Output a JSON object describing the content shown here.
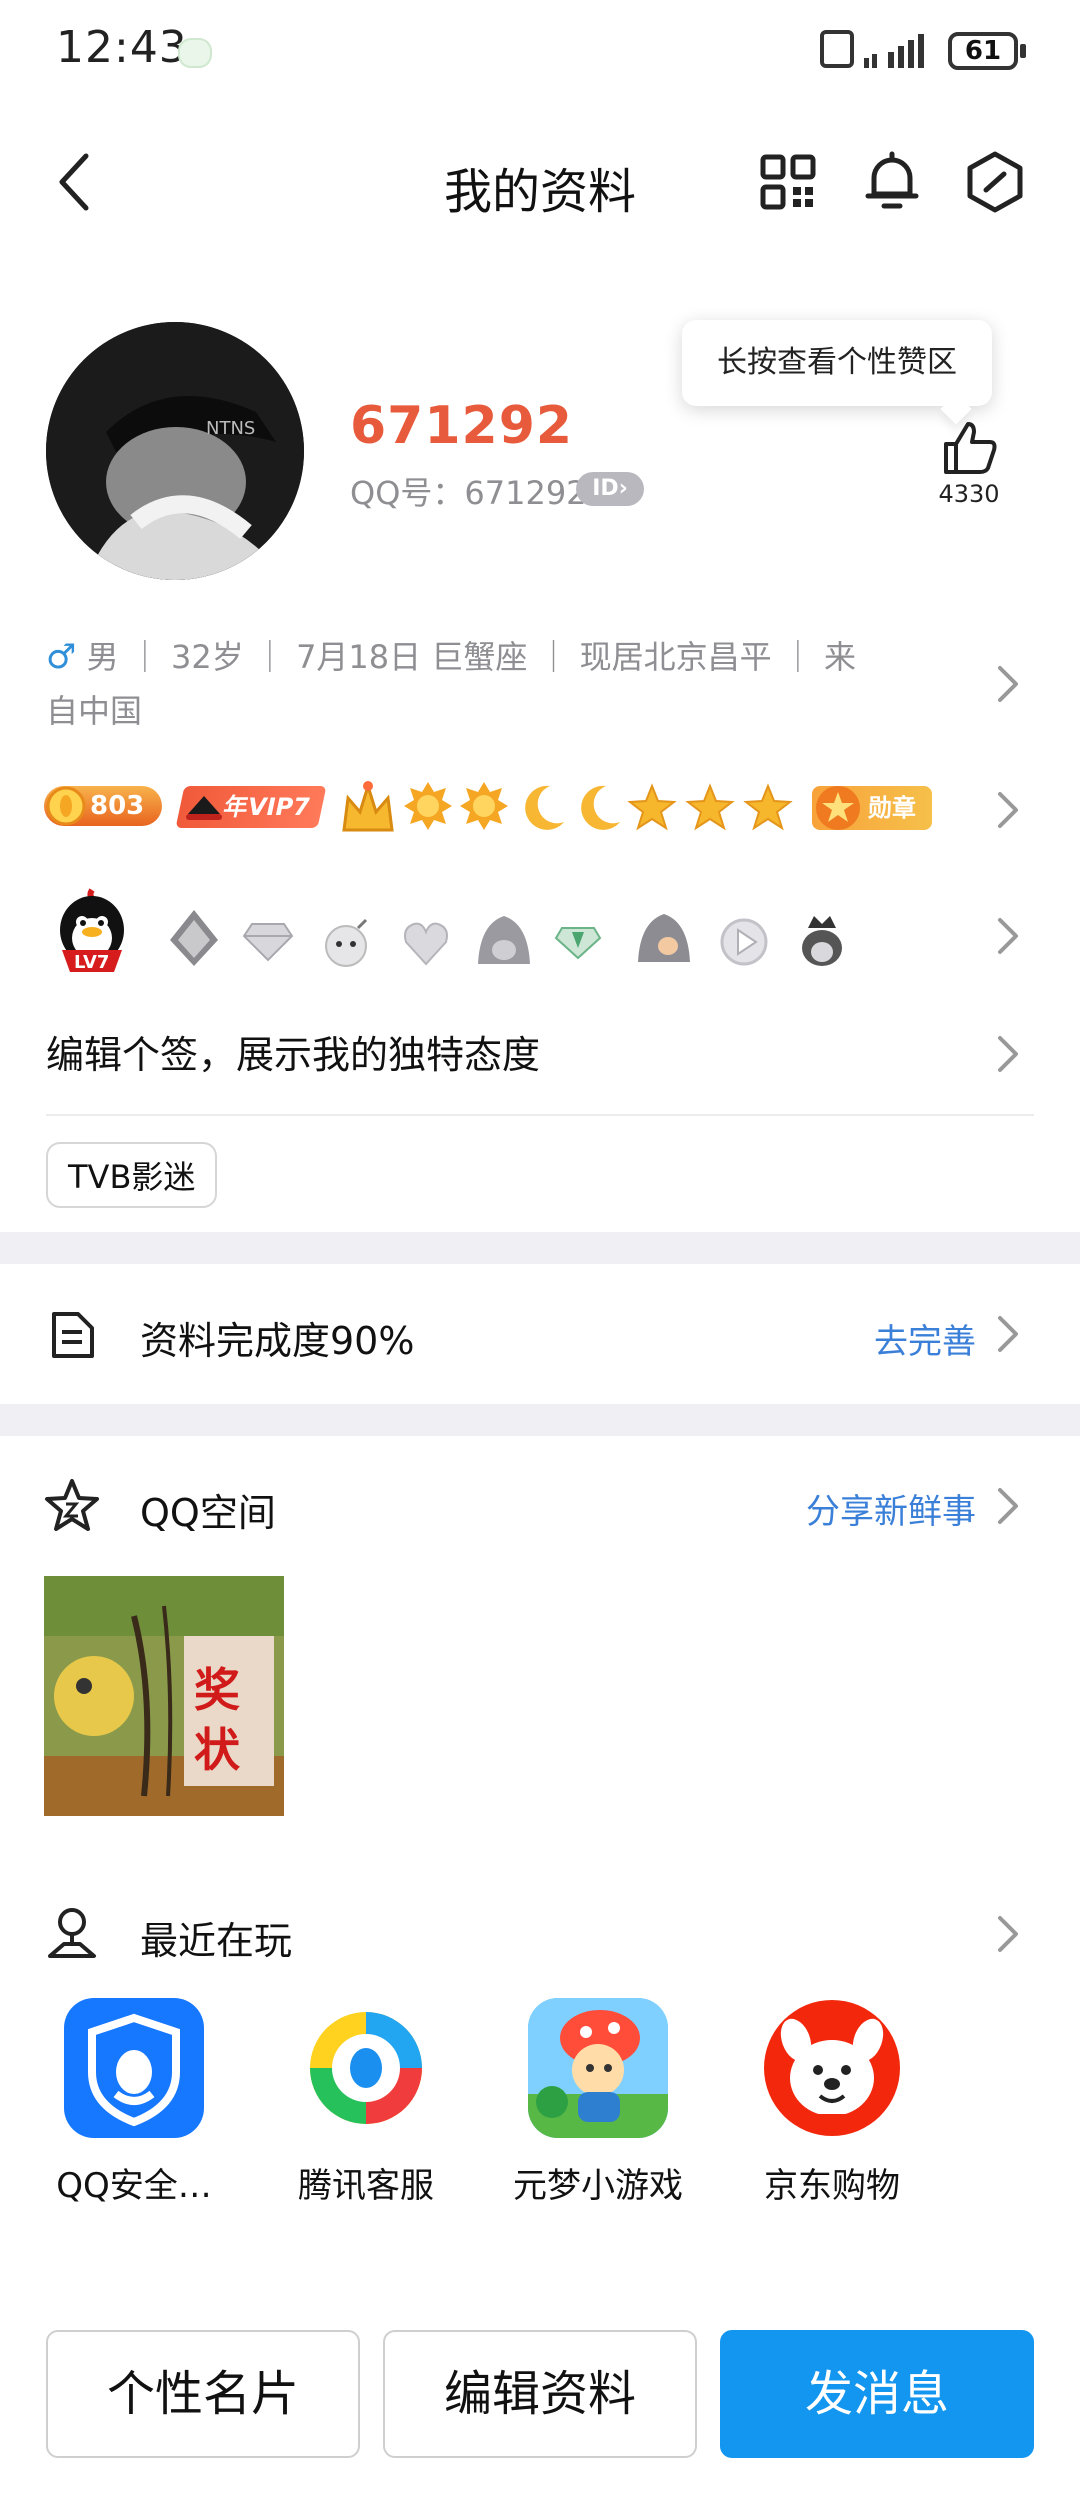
{
  "status_bar": {
    "time": "12:43",
    "battery": "61"
  },
  "header": {
    "title": "我的资料"
  },
  "profile": {
    "nickname": "671292",
    "qq_label": "QQ号：671292",
    "id_badge": "ID",
    "like_tooltip": "长按查看个性赞区",
    "like_count": "4330"
  },
  "info": {
    "gender_symbol": "♂",
    "line1": " 男 ｜ 32岁 ｜ 7月18日  巨蟹座 ｜ 现居北京昌平 ｜ 来",
    "line2": "自中国"
  },
  "badges": {
    "score": "803",
    "vip": "年VIP7",
    "medal": "勋章"
  },
  "level_badge": "LV7",
  "signature": "编辑个签，展示我的独特态度",
  "tag": "TVB影迷",
  "completion": {
    "label": "资料完成度90%",
    "action": "去完善"
  },
  "qzone": {
    "label": "QQ空间",
    "action": "分享新鲜事",
    "photo_text": [
      "奖",
      "状"
    ]
  },
  "recent": {
    "label": "最近在玩",
    "games": [
      {
        "name": "QQ安全…"
      },
      {
        "name": "腾讯客服"
      },
      {
        "name": "元梦小游戏"
      },
      {
        "name": "京东购物"
      }
    ]
  },
  "buttons": {
    "card": "个性名片",
    "edit": "编辑资料",
    "message": "发消息"
  },
  "colors": {
    "accent_blue": "#1296f0",
    "link_blue": "#3a7fd8",
    "nickname_red": "#e85a3c"
  }
}
